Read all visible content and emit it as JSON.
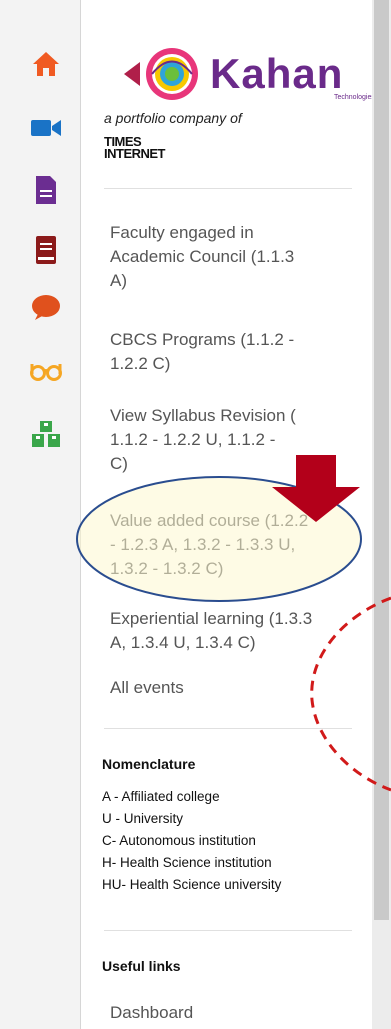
{
  "rail": {
    "icons": [
      "home-icon",
      "video-camera-icon",
      "document-icon",
      "book-icon",
      "chat-bubble-icon",
      "glasses-icon",
      "blocks-icon"
    ]
  },
  "brand": {
    "logo_text": "Kahan",
    "logo_sub": "Technologies",
    "portfolio": "a portfolio company of",
    "times_line1": "TIMES",
    "times_line2": "INTERNET"
  },
  "nav": {
    "faculty": [
      "Faculty engaged in",
      "Academic Council (1.1.3",
      "A)"
    ],
    "cbcs": [
      "CBCS Programs (1.1.2 -",
      "1.2.2 C)"
    ],
    "syllabus": [
      "View Syllabus Revision (",
      "1.1.2 - 1.2.2 U, 1.1.2 -",
      "C)"
    ],
    "value_added": [
      "Value added course (1.2.2",
      "- 1.2.3 A, 1.3.2 - 1.3.3 U,",
      "1.3.2 - 1.3.2 C)"
    ],
    "experiential": [
      "Experiential learning (1.3.3",
      "A, 1.3.4 U, 1.3.4 C)"
    ],
    "all_events": "All events"
  },
  "nomenclature": {
    "title": "Nomenclature",
    "lines": [
      "A - Affiliated college",
      "U - University",
      "C- Autonomous institution",
      "H- Health Science institution",
      "HU- Health Science university"
    ]
  },
  "useful_links": {
    "title": "Useful links",
    "dashboard": "Dashboard"
  },
  "colors": {
    "home": "#f05a22",
    "video": "#1a73c6",
    "document": "#6b2d91",
    "book": "#8b1a1a",
    "chat": "#e0511d",
    "glasses": "#f5a623",
    "blocks": "#3aa64a",
    "highlight_fill": "#fdf8cf",
    "highlight_stroke": "#2a4d8f",
    "arrow": "#b3001a",
    "dashed": "#d11a1a"
  }
}
